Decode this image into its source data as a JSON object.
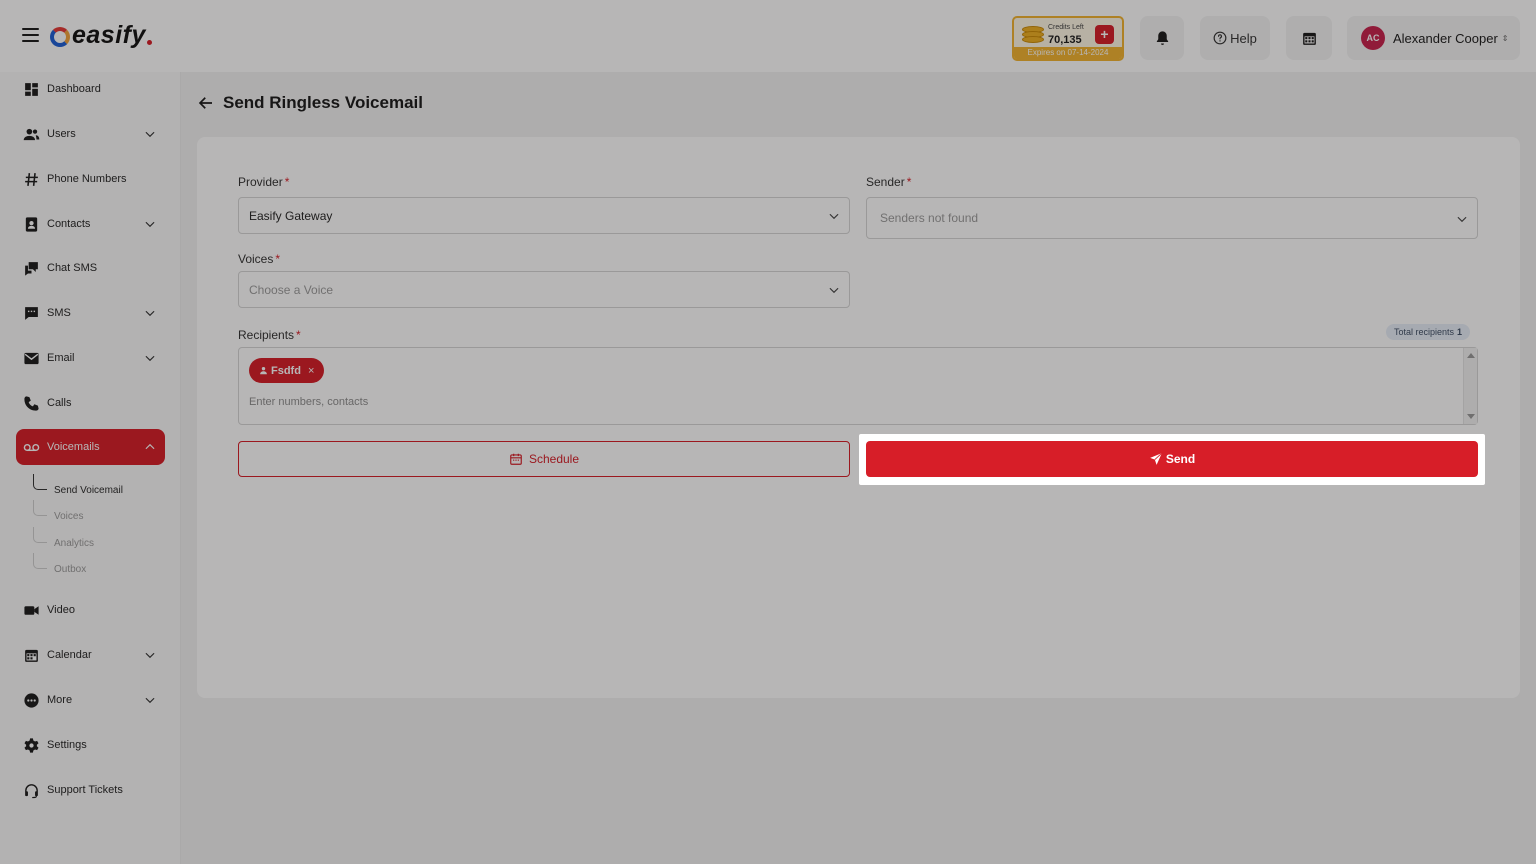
{
  "brand": {
    "name": "easify"
  },
  "header": {
    "credits_label": "Credits Left",
    "credits_value": "70,135",
    "credits_add": "+",
    "credits_expiry": "Expires on 07-14-2024",
    "help_label": "Help",
    "user_initials": "AC",
    "user_name": "Alexander Cooper"
  },
  "sidebar": {
    "items": {
      "dashboard": "Dashboard",
      "users": "Users",
      "phone_numbers": "Phone Numbers",
      "contacts": "Contacts",
      "chat_sms": "Chat SMS",
      "sms": "SMS",
      "email": "Email",
      "calls": "Calls",
      "voicemails": "Voicemails",
      "video": "Video",
      "calendar": "Calendar",
      "more": "More",
      "settings": "Settings",
      "support_tickets": "Support Tickets"
    },
    "voicemail_sub": {
      "send_voicemail": "Send Voicemail",
      "voices": "Voices",
      "analytics": "Analytics",
      "outbox": "Outbox"
    }
  },
  "page": {
    "title": "Send Ringless Voicemail"
  },
  "form": {
    "provider_label": "Provider",
    "provider_value": "Easify Gateway",
    "sender_label": "Sender",
    "sender_value": "Senders not found",
    "voices_label": "Voices",
    "voices_placeholder": "Choose a Voice",
    "recipients_label": "Recipients",
    "required_mark": "*",
    "total_recipients_label": "Total recipients",
    "total_recipients_count": "1",
    "recipient_chip": "Fsdfd",
    "recipient_chip_remove": "×",
    "recipients_placeholder": "Enter numbers, contacts",
    "schedule_button": "Schedule",
    "send_button": "Send"
  },
  "colors": {
    "accent": "#d71e28",
    "credits": "#f2b430"
  }
}
